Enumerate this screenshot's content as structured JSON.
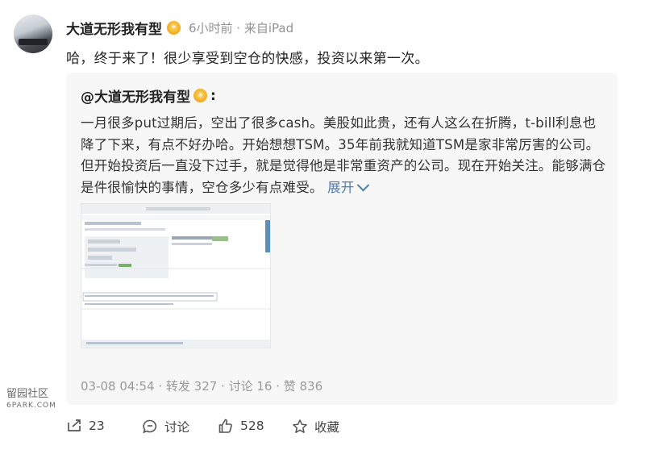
{
  "post": {
    "username": "大道无形我有型",
    "meta": "6小时前 · 来自iPad",
    "text": "哈，终于来了！很少享受到空仓的快感，投资以来第一次。"
  },
  "quote": {
    "author": "@大道无形我有型",
    "colon": ":",
    "body": "一月很多put过期后，空出了很多cash。美股如此贵，还有人这么在折腾，t-bill利息也降了下来，有点不好办哈。开始想想TSM。35年前我就知道TSM是家非常厉害的公司。但开始投资后一直没下过手，就是觉得他是非常重资产的公司。现在开始关注。能够满仓是件很愉快的事情，空仓多少有点难受。",
    "expand_label": "展开",
    "footer": "03-08 04:54 · 转发 327 · 讨论 16 · 赞 836"
  },
  "actions": {
    "repost": "23",
    "comment": "讨论",
    "like": "528",
    "favorite": "收藏"
  },
  "watermark": {
    "line1": "留园社区",
    "line2": "6PARK.COM"
  },
  "icons": {
    "badge": "sun-badge-icon",
    "repost": "repost-icon",
    "comment": "comment-icon",
    "like": "thumbs-up-icon",
    "favorite": "star-icon",
    "expand": "chevron-down-icon"
  },
  "colors": {
    "link": "#507daf",
    "meta": "#939393",
    "badge": "#f2a91c"
  }
}
